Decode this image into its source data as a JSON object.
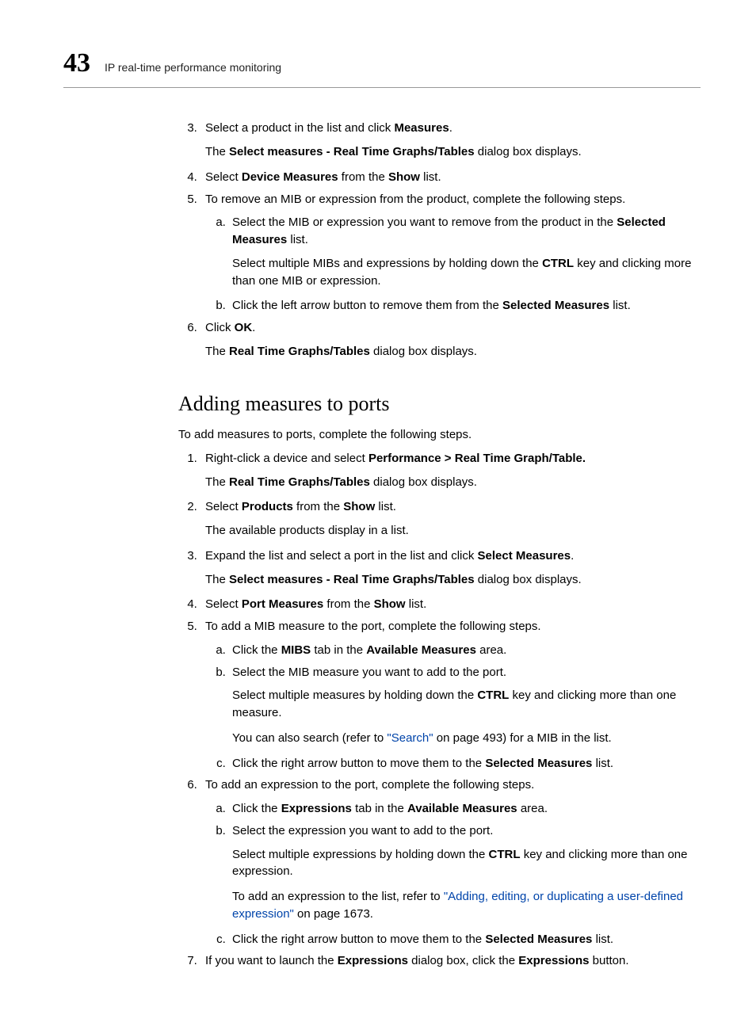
{
  "header": {
    "chapter_number": "43",
    "running_title": "IP real-time performance monitoring"
  },
  "section1": {
    "items": {
      "3": {
        "pre": "Select a product in the list and click ",
        "bold": "Measures",
        "post": ".",
        "follow_pre": "The ",
        "follow_bold": "Select measures - Real Time Graphs/Tables",
        "follow_post": " dialog box displays."
      },
      "4": {
        "pre": "Select ",
        "b1": "Device Measures",
        "mid": " from the ",
        "b2": "Show",
        "post": " list."
      },
      "5": {
        "text": "To remove an MIB or expression from the product, complete the following steps.",
        "a": {
          "pre": "Select the MIB or expression you want to remove from the product in the ",
          "b1": "Selected Measures",
          "post": " list.",
          "f_pre": "Select multiple MIBs and expressions by holding down the ",
          "f_b": "CTRL",
          "f_post": " key and clicking more than one MIB or expression."
        },
        "b": {
          "pre": "Click the left arrow button to remove them from the ",
          "b1": "Selected Measures",
          "post": " list."
        }
      },
      "6": {
        "pre": "Click ",
        "b1": "OK",
        "post": ".",
        "f_pre": "The ",
        "f_b": "Real Time Graphs/Tables",
        "f_post": " dialog box displays."
      }
    }
  },
  "section2": {
    "heading": "Adding measures to ports",
    "intro": "To add measures to ports, complete the following steps.",
    "items": {
      "1": {
        "pre": "Right-click a device and select ",
        "b1": "Performance > Real Time Graph/Table.",
        "f_pre": "The ",
        "f_b": "Real Time Graphs/Tables",
        "f_post": " dialog box displays."
      },
      "2": {
        "pre": "Select ",
        "b1": "Products",
        "mid": " from the ",
        "b2": "Show",
        "post": " list.",
        "f": "The available products display in a list."
      },
      "3": {
        "pre": "Expand the list and select a port in the list and click ",
        "b1": "Select Measures",
        "post": ".",
        "f_pre": "The ",
        "f_b": "Select measures - Real Time Graphs/Tables",
        "f_post": " dialog box displays."
      },
      "4": {
        "pre": "Select ",
        "b1": "Port Measures",
        "mid": " from the ",
        "b2": "Show",
        "post": " list."
      },
      "5": {
        "text": "To add a MIB measure to the port, complete the following steps.",
        "a": {
          "pre": "Click the ",
          "b1": "MIBS",
          "mid": " tab in the ",
          "b2": "Available Measures",
          "post": " area."
        },
        "b": {
          "text": "Select the MIB measure you want to add to the port.",
          "f_pre": "Select multiple measures by holding down the ",
          "f_b": "CTRL",
          "f_post": " key and clicking more than one measure.",
          "g_pre": "You can also search (refer to ",
          "g_link": "\"Search\"",
          "g_post": " on page 493) for a MIB in the list."
        },
        "c": {
          "pre": "Click the right arrow button to move them to the ",
          "b1": "Selected Measures",
          "post": " list."
        }
      },
      "6": {
        "text": "To add an expression to the port, complete the following steps.",
        "a": {
          "pre": "Click the ",
          "b1": "Expressions",
          "mid": " tab in the ",
          "b2": "Available Measures",
          "post": " area."
        },
        "b": {
          "text": "Select the expression you want to add to the port.",
          "f_pre": "Select multiple expressions by holding down the ",
          "f_b": "CTRL",
          "f_post": " key and clicking more than one expression.",
          "g_pre": "To add an expression to the list, refer to ",
          "g_link": "\"Adding, editing, or duplicating a user-defined expression\"",
          "g_post": " on page 1673."
        },
        "c": {
          "pre": "Click the right arrow button to move them to the ",
          "b1": "Selected Measures",
          "post": " list."
        }
      },
      "7": {
        "pre": "If you want to launch the ",
        "b1": "Expressions",
        "mid": " dialog box, click the ",
        "b2": "Expressions",
        "post": " button."
      }
    }
  }
}
